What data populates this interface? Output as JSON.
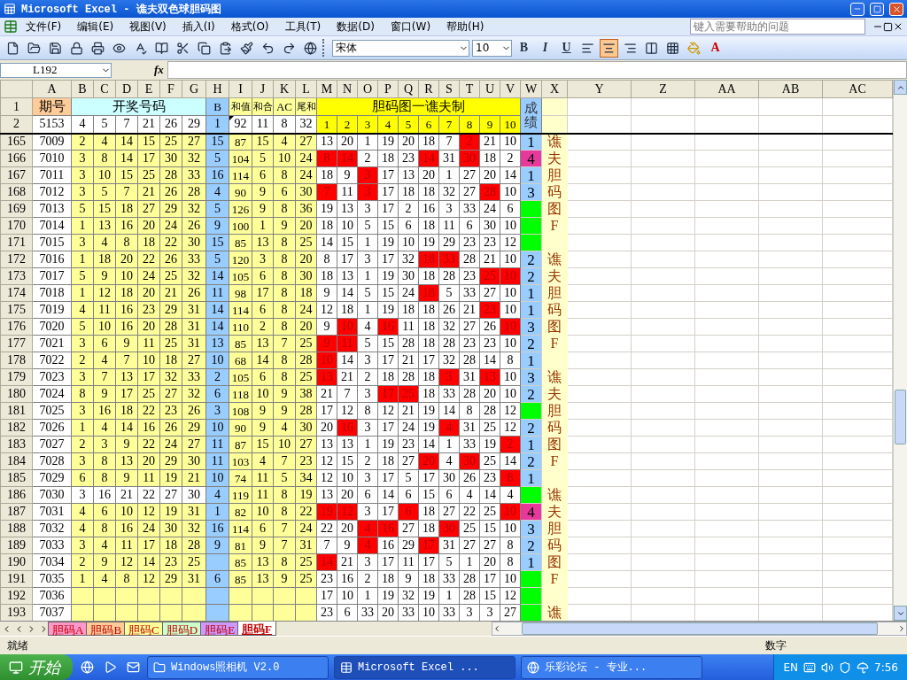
{
  "window": {
    "title": "Microsoft Excel - 谯夫双色球胆码图"
  },
  "menu": {
    "items": [
      "文件(F)",
      "编辑(E)",
      "视图(V)",
      "插入(I)",
      "格式(O)",
      "工具(T)",
      "数据(D)",
      "窗口(W)",
      "帮助(H)"
    ],
    "help_placeholder": "键入需要帮助的问题"
  },
  "toolbar": {
    "font": "宋体",
    "size": "10",
    "format_buttons": [
      "B",
      "I",
      "U"
    ],
    "align_buttons": [
      {
        "selected": false
      },
      {
        "selected": true
      },
      {
        "selected": false
      }
    ],
    "font_color_glyph": "A"
  },
  "formula_bar": {
    "name_box": "L192",
    "function_label": "fx"
  },
  "columns": [
    "A",
    "B",
    "C",
    "D",
    "E",
    "F",
    "G",
    "H",
    "I",
    "J",
    "K",
    "L",
    "M",
    "N",
    "O",
    "P",
    "Q",
    "R",
    "S",
    "T",
    "U",
    "V",
    "W",
    "X",
    "Y",
    "Z",
    "AA",
    "AB",
    "AC"
  ],
  "header": {
    "row1": {
      "num": "1",
      "issue": "期号",
      "balls": "开奖号码",
      "b": "B",
      "sum": "和值",
      "hh": "和合",
      "ac": "AC",
      "wh": "尾和",
      "dan": "胆码图一谯夫制",
      "score": "成绩"
    },
    "row2": {
      "num": "2",
      "id": "5153",
      "balls": [
        "4",
        "5",
        "7",
        "21",
        "26",
        "29"
      ],
      "b": "1",
      "sum": "92",
      "hh": "11",
      "ac": "8",
      "wh": "32",
      "dan": [
        "1",
        "2",
        "3",
        "4",
        "5",
        "6",
        "7",
        "8",
        "9",
        "10"
      ]
    }
  },
  "rows": [
    {
      "num": "165",
      "id": "7009",
      "shaded": true,
      "balls": [
        "2",
        "4",
        "14",
        "15",
        "25",
        "27"
      ],
      "b": "15",
      "sum": "87",
      "hh": "15",
      "ac": "4",
      "wh": "27",
      "dan": [
        {
          "value": "13",
          "hit": false
        },
        {
          "value": "20",
          "hit": false
        },
        {
          "value": "1",
          "hit": false
        },
        {
          "value": "19",
          "hit": false
        },
        {
          "value": "20",
          "hit": false
        },
        {
          "value": "18",
          "hit": false
        },
        {
          "value": "7",
          "hit": false
        },
        {
          "value": "2",
          "hit": true
        },
        {
          "value": "21",
          "hit": false
        },
        {
          "value": "10",
          "hit": false
        }
      ],
      "score": "1",
      "color": "#99ccff",
      "side": "谯"
    },
    {
      "num": "166",
      "id": "7010",
      "shaded": true,
      "balls": [
        "3",
        "8",
        "14",
        "17",
        "30",
        "32"
      ],
      "b": "5",
      "sum": "104",
      "hh": "5",
      "ac": "10",
      "wh": "24",
      "dan": [
        {
          "value": "8",
          "hit": true
        },
        {
          "value": "14",
          "hit": true
        },
        {
          "value": "2",
          "hit": false
        },
        {
          "value": "18",
          "hit": false
        },
        {
          "value": "23",
          "hit": false
        },
        {
          "value": "14",
          "hit": true
        },
        {
          "value": "31",
          "hit": false
        },
        {
          "value": "30",
          "hit": true
        },
        {
          "value": "18",
          "hit": false
        },
        {
          "value": "2",
          "hit": false
        }
      ],
      "score": "4",
      "color": "#e6399b",
      "side": "夫"
    },
    {
      "num": "167",
      "id": "7011",
      "shaded": true,
      "balls": [
        "3",
        "10",
        "15",
        "25",
        "28",
        "33"
      ],
      "b": "16",
      "sum": "114",
      "hh": "6",
      "ac": "8",
      "wh": "24",
      "dan": [
        {
          "value": "18",
          "hit": false
        },
        {
          "value": "9",
          "hit": false
        },
        {
          "value": "3",
          "hit": true
        },
        {
          "value": "17",
          "hit": false
        },
        {
          "value": "13",
          "hit": false
        },
        {
          "value": "20",
          "hit": false
        },
        {
          "value": "1",
          "hit": false
        },
        {
          "value": "27",
          "hit": false
        },
        {
          "value": "20",
          "hit": false
        },
        {
          "value": "14",
          "hit": false
        }
      ],
      "score": "1",
      "color": "#99ccff",
      "side": "胆"
    },
    {
      "num": "168",
      "id": "7012",
      "shaded": true,
      "balls": [
        "3",
        "5",
        "7",
        "21",
        "26",
        "28"
      ],
      "b": "4",
      "sum": "90",
      "hh": "9",
      "ac": "6",
      "wh": "30",
      "dan": [
        {
          "value": "7",
          "hit": true
        },
        {
          "value": "11",
          "hit": false
        },
        {
          "value": "3",
          "hit": true
        },
        {
          "value": "17",
          "hit": false
        },
        {
          "value": "18",
          "hit": false
        },
        {
          "value": "18",
          "hit": false
        },
        {
          "value": "32",
          "hit": false
        },
        {
          "value": "27",
          "hit": false
        },
        {
          "value": "28",
          "hit": true
        },
        {
          "value": "10",
          "hit": false
        }
      ],
      "score": "3",
      "color": "#99ccff",
      "side": "码"
    },
    {
      "num": "169",
      "id": "7013",
      "shaded": true,
      "balls": [
        "5",
        "15",
        "18",
        "27",
        "29",
        "32"
      ],
      "b": "5",
      "sum": "126",
      "hh": "9",
      "ac": "8",
      "wh": "36",
      "dan": [
        {
          "value": "19",
          "hit": false
        },
        {
          "value": "13",
          "hit": false
        },
        {
          "value": "3",
          "hit": false
        },
        {
          "value": "17",
          "hit": false
        },
        {
          "value": "2",
          "hit": false
        },
        {
          "value": "16",
          "hit": false
        },
        {
          "value": "3",
          "hit": false
        },
        {
          "value": "33",
          "hit": false
        },
        {
          "value": "24",
          "hit": false
        },
        {
          "value": "6",
          "hit": false
        }
      ],
      "color": "#00ff00",
      "side": "图"
    },
    {
      "num": "170",
      "id": "7014",
      "shaded": true,
      "balls": [
        "1",
        "13",
        "16",
        "20",
        "24",
        "26"
      ],
      "b": "9",
      "sum": "100",
      "hh": "1",
      "ac": "9",
      "wh": "20",
      "dan": [
        {
          "value": "18",
          "hit": false
        },
        {
          "value": "10",
          "hit": false
        },
        {
          "value": "5",
          "hit": false
        },
        {
          "value": "15",
          "hit": false
        },
        {
          "value": "6",
          "hit": false
        },
        {
          "value": "18",
          "hit": false
        },
        {
          "value": "11",
          "hit": false
        },
        {
          "value": "6",
          "hit": false
        },
        {
          "value": "30",
          "hit": false
        },
        {
          "value": "10",
          "hit": false
        }
      ],
      "color": "#00ff00",
      "side": "F"
    },
    {
      "num": "171",
      "id": "7015",
      "shaded": true,
      "balls": [
        "3",
        "4",
        "8",
        "18",
        "22",
        "30"
      ],
      "b": "15",
      "sum": "85",
      "hh": "13",
      "ac": "8",
      "wh": "25",
      "dan": [
        {
          "value": "14",
          "hit": false
        },
        {
          "value": "15",
          "hit": false
        },
        {
          "value": "1",
          "hit": false
        },
        {
          "value": "19",
          "hit": false
        },
        {
          "value": "10",
          "hit": false
        },
        {
          "value": "19",
          "hit": false
        },
        {
          "value": "29",
          "hit": false
        },
        {
          "value": "23",
          "hit": false
        },
        {
          "value": "23",
          "hit": false
        },
        {
          "value": "12",
          "hit": false
        }
      ],
      "color": "#00ff00"
    },
    {
      "num": "172",
      "id": "7016",
      "shaded": true,
      "balls": [
        "1",
        "18",
        "20",
        "22",
        "26",
        "33"
      ],
      "b": "5",
      "sum": "120",
      "hh": "3",
      "ac": "8",
      "wh": "20",
      "dan": [
        {
          "value": "8",
          "hit": false
        },
        {
          "value": "17",
          "hit": false
        },
        {
          "value": "3",
          "hit": false
        },
        {
          "value": "17",
          "hit": false
        },
        {
          "value": "32",
          "hit": false
        },
        {
          "value": "18",
          "hit": true
        },
        {
          "value": "33",
          "hit": true
        },
        {
          "value": "28",
          "hit": false
        },
        {
          "value": "21",
          "hit": false
        },
        {
          "value": "10",
          "hit": false
        }
      ],
      "score": "2",
      "color": "#99ccff",
      "side": "谯"
    },
    {
      "num": "173",
      "id": "7017",
      "shaded": true,
      "balls": [
        "5",
        "9",
        "10",
        "24",
        "25",
        "32"
      ],
      "b": "14",
      "sum": "105",
      "hh": "6",
      "ac": "8",
      "wh": "30",
      "dan": [
        {
          "value": "18",
          "hit": false
        },
        {
          "value": "13",
          "hit": false
        },
        {
          "value": "1",
          "hit": false
        },
        {
          "value": "19",
          "hit": false
        },
        {
          "value": "30",
          "hit": false
        },
        {
          "value": "18",
          "hit": false
        },
        {
          "value": "28",
          "hit": false
        },
        {
          "value": "23",
          "hit": false
        },
        {
          "value": "25",
          "hit": true
        },
        {
          "value": "10",
          "hit": true
        }
      ],
      "score": "2",
      "color": "#99ccff",
      "side": "夫"
    },
    {
      "num": "174",
      "id": "7018",
      "shaded": true,
      "balls": [
        "1",
        "12",
        "18",
        "20",
        "21",
        "26"
      ],
      "b": "11",
      "sum": "98",
      "hh": "17",
      "ac": "8",
      "wh": "18",
      "dan": [
        {
          "value": "9",
          "hit": false
        },
        {
          "value": "14",
          "hit": false
        },
        {
          "value": "5",
          "hit": false
        },
        {
          "value": "15",
          "hit": false
        },
        {
          "value": "24",
          "hit": false
        },
        {
          "value": "18",
          "hit": true
        },
        {
          "value": "5",
          "hit": false
        },
        {
          "value": "33",
          "hit": false
        },
        {
          "value": "27",
          "hit": false
        },
        {
          "value": "10",
          "hit": false
        }
      ],
      "score": "1",
      "color": "#99ccff",
      "side": "胆"
    },
    {
      "num": "175",
      "id": "7019",
      "shaded": true,
      "balls": [
        "4",
        "11",
        "16",
        "23",
        "29",
        "31"
      ],
      "b": "14",
      "sum": "114",
      "hh": "6",
      "ac": "8",
      "wh": "24",
      "dan": [
        {
          "value": "12",
          "hit": false
        },
        {
          "value": "18",
          "hit": false
        },
        {
          "value": "1",
          "hit": false
        },
        {
          "value": "19",
          "hit": false
        },
        {
          "value": "18",
          "hit": false
        },
        {
          "value": "18",
          "hit": false
        },
        {
          "value": "26",
          "hit": false
        },
        {
          "value": "21",
          "hit": false
        },
        {
          "value": "23",
          "hit": true
        },
        {
          "value": "10",
          "hit": false
        }
      ],
      "score": "1",
      "color": "#99ccff",
      "side": "码"
    },
    {
      "num": "176",
      "id": "7020",
      "shaded": true,
      "balls": [
        "5",
        "10",
        "16",
        "20",
        "28",
        "31"
      ],
      "b": "14",
      "sum": "110",
      "hh": "2",
      "ac": "8",
      "wh": "20",
      "dan": [
        {
          "value": "9",
          "hit": false
        },
        {
          "value": "10",
          "hit": true
        },
        {
          "value": "4",
          "hit": false
        },
        {
          "value": "16",
          "hit": true
        },
        {
          "value": "11",
          "hit": false
        },
        {
          "value": "18",
          "hit": false
        },
        {
          "value": "32",
          "hit": false
        },
        {
          "value": "27",
          "hit": false
        },
        {
          "value": "26",
          "hit": false
        },
        {
          "value": "10",
          "hit": true
        }
      ],
      "score": "3",
      "color": "#99ccff",
      "side": "图"
    },
    {
      "num": "177",
      "id": "7021",
      "shaded": true,
      "balls": [
        "3",
        "6",
        "9",
        "11",
        "25",
        "31"
      ],
      "b": "13",
      "sum": "85",
      "hh": "13",
      "ac": "7",
      "wh": "25",
      "dan": [
        {
          "value": "9",
          "hit": true
        },
        {
          "value": "11",
          "hit": true
        },
        {
          "value": "5",
          "hit": false
        },
        {
          "value": "15",
          "hit": false
        },
        {
          "value": "28",
          "hit": false
        },
        {
          "value": "18",
          "hit": false
        },
        {
          "value": "28",
          "hit": false
        },
        {
          "value": "23",
          "hit": false
        },
        {
          "value": "23",
          "hit": false
        },
        {
          "value": "10",
          "hit": false
        }
      ],
      "score": "2",
      "color": "#99ccff",
      "side": "F"
    },
    {
      "num": "178",
      "id": "7022",
      "shaded": true,
      "balls": [
        "2",
        "4",
        "7",
        "10",
        "18",
        "27"
      ],
      "b": "10",
      "sum": "68",
      "hh": "14",
      "ac": "8",
      "wh": "28",
      "dan": [
        {
          "value": "10",
          "hit": true
        },
        {
          "value": "14",
          "hit": false
        },
        {
          "value": "3",
          "hit": false
        },
        {
          "value": "17",
          "hit": false
        },
        {
          "value": "21",
          "hit": false
        },
        {
          "value": "17",
          "hit": false
        },
        {
          "value": "32",
          "hit": false
        },
        {
          "value": "28",
          "hit": false
        },
        {
          "value": "14",
          "hit": false
        },
        {
          "value": "8",
          "hit": false
        }
      ],
      "score": "1",
      "color": "#99ccff"
    },
    {
      "num": "179",
      "id": "7023",
      "shaded": true,
      "balls": [
        "3",
        "7",
        "13",
        "17",
        "32",
        "33"
      ],
      "b": "2",
      "sum": "105",
      "hh": "6",
      "ac": "8",
      "wh": "25",
      "dan": [
        {
          "value": "13",
          "hit": true
        },
        {
          "value": "21",
          "hit": false
        },
        {
          "value": "2",
          "hit": false
        },
        {
          "value": "18",
          "hit": false
        },
        {
          "value": "28",
          "hit": false
        },
        {
          "value": "18",
          "hit": false
        },
        {
          "value": "3",
          "hit": true
        },
        {
          "value": "31",
          "hit": false
        },
        {
          "value": "13",
          "hit": true
        },
        {
          "value": "10",
          "hit": false
        }
      ],
      "score": "3",
      "color": "#99ccff",
      "side": "谯"
    },
    {
      "num": "180",
      "id": "7024",
      "shaded": true,
      "balls": [
        "8",
        "9",
        "17",
        "25",
        "27",
        "32"
      ],
      "b": "6",
      "sum": "118",
      "hh": "10",
      "ac": "9",
      "wh": "38",
      "dan": [
        {
          "value": "21",
          "hit": false
        },
        {
          "value": "7",
          "hit": false
        },
        {
          "value": "3",
          "hit": false
        },
        {
          "value": "17",
          "hit": true
        },
        {
          "value": "25",
          "hit": true
        },
        {
          "value": "18",
          "hit": false
        },
        {
          "value": "33",
          "hit": false
        },
        {
          "value": "28",
          "hit": false
        },
        {
          "value": "20",
          "hit": false
        },
        {
          "value": "10",
          "hit": false
        }
      ],
      "score": "2",
      "color": "#99ccff",
      "side": "夫"
    },
    {
      "num": "181",
      "id": "7025",
      "shaded": true,
      "balls": [
        "3",
        "16",
        "18",
        "22",
        "23",
        "26"
      ],
      "b": "3",
      "sum": "108",
      "hh": "9",
      "ac": "9",
      "wh": "28",
      "dan": [
        {
          "value": "17",
          "hit": false
        },
        {
          "value": "12",
          "hit": false
        },
        {
          "value": "8",
          "hit": false
        },
        {
          "value": "12",
          "hit": false
        },
        {
          "value": "21",
          "hit": false
        },
        {
          "value": "19",
          "hit": false
        },
        {
          "value": "14",
          "hit": false
        },
        {
          "value": "8",
          "hit": false
        },
        {
          "value": "28",
          "hit": false
        },
        {
          "value": "12",
          "hit": false
        }
      ],
      "color": "#00ff00",
      "side": "胆"
    },
    {
      "num": "182",
      "id": "7026",
      "shaded": true,
      "balls": [
        "1",
        "4",
        "14",
        "16",
        "26",
        "29"
      ],
      "b": "10",
      "sum": "90",
      "hh": "9",
      "ac": "4",
      "wh": "30",
      "dan": [
        {
          "value": "20",
          "hit": false
        },
        {
          "value": "16",
          "hit": true
        },
        {
          "value": "3",
          "hit": false
        },
        {
          "value": "17",
          "hit": false
        },
        {
          "value": "24",
          "hit": false
        },
        {
          "value": "19",
          "hit": false
        },
        {
          "value": "4",
          "hit": true
        },
        {
          "value": "31",
          "hit": false
        },
        {
          "value": "25",
          "hit": false
        },
        {
          "value": "12",
          "hit": false
        }
      ],
      "score": "2",
      "color": "#99ccff",
      "side": "码"
    },
    {
      "num": "183",
      "id": "7027",
      "shaded": true,
      "balls": [
        "2",
        "3",
        "9",
        "22",
        "24",
        "27"
      ],
      "b": "11",
      "sum": "87",
      "hh": "15",
      "ac": "10",
      "wh": "27",
      "dan": [
        {
          "value": "13",
          "hit": false
        },
        {
          "value": "13",
          "hit": false
        },
        {
          "value": "1",
          "hit": false
        },
        {
          "value": "19",
          "hit": false
        },
        {
          "value": "23",
          "hit": false
        },
        {
          "value": "14",
          "hit": false
        },
        {
          "value": "1",
          "hit": false
        },
        {
          "value": "33",
          "hit": false
        },
        {
          "value": "19",
          "hit": false
        },
        {
          "value": "2",
          "hit": true
        }
      ],
      "score": "1",
      "color": "#99ccff",
      "side": "图"
    },
    {
      "num": "184",
      "id": "7028",
      "shaded": true,
      "balls": [
        "3",
        "8",
        "13",
        "20",
        "29",
        "30"
      ],
      "b": "11",
      "sum": "103",
      "hh": "4",
      "ac": "7",
      "wh": "23",
      "dan": [
        {
          "value": "12",
          "hit": false
        },
        {
          "value": "15",
          "hit": false
        },
        {
          "value": "2",
          "hit": false
        },
        {
          "value": "18",
          "hit": false
        },
        {
          "value": "27",
          "hit": false
        },
        {
          "value": "20",
          "hit": true
        },
        {
          "value": "4",
          "hit": false
        },
        {
          "value": "30",
          "hit": true
        },
        {
          "value": "25",
          "hit": false
        },
        {
          "value": "14",
          "hit": false
        }
      ],
      "score": "2",
      "color": "#99ccff",
      "side": "F"
    },
    {
      "num": "185",
      "id": "7029",
      "shaded": true,
      "balls": [
        "6",
        "8",
        "9",
        "11",
        "19",
        "21"
      ],
      "b": "10",
      "sum": "74",
      "hh": "11",
      "ac": "5",
      "wh": "34",
      "dan": [
        {
          "value": "12",
          "hit": false
        },
        {
          "value": "10",
          "hit": false
        },
        {
          "value": "3",
          "hit": false
        },
        {
          "value": "17",
          "hit": false
        },
        {
          "value": "5",
          "hit": false
        },
        {
          "value": "17",
          "hit": false
        },
        {
          "value": "30",
          "hit": false
        },
        {
          "value": "26",
          "hit": false
        },
        {
          "value": "23",
          "hit": false
        },
        {
          "value": "8",
          "hit": true
        }
      ],
      "score": "1",
      "color": "#99ccff"
    },
    {
      "num": "186",
      "id": "7030",
      "shaded": false,
      "balls": [
        "3",
        "16",
        "21",
        "22",
        "27",
        "30"
      ],
      "b": "4",
      "sum": "119",
      "hh": "11",
      "ac": "8",
      "wh": "19",
      "dan": [
        {
          "value": "13",
          "hit": false
        },
        {
          "value": "20",
          "hit": false
        },
        {
          "value": "6",
          "hit": false
        },
        {
          "value": "14",
          "hit": false
        },
        {
          "value": "6",
          "hit": false
        },
        {
          "value": "15",
          "hit": false
        },
        {
          "value": "6",
          "hit": false
        },
        {
          "value": "4",
          "hit": false
        },
        {
          "value": "14",
          "hit": false
        },
        {
          "value": "4",
          "hit": false
        }
      ],
      "color": "#00ff00",
      "side": "谯"
    },
    {
      "num": "187",
      "id": "7031",
      "shaded": true,
      "balls": [
        "4",
        "6",
        "10",
        "12",
        "19",
        "31"
      ],
      "b": "1",
      "sum": "82",
      "hh": "10",
      "ac": "8",
      "wh": "22",
      "dan": [
        {
          "value": "19",
          "hit": true
        },
        {
          "value": "12",
          "hit": true
        },
        {
          "value": "3",
          "hit": false
        },
        {
          "value": "17",
          "hit": false
        },
        {
          "value": "6",
          "hit": true
        },
        {
          "value": "18",
          "hit": false
        },
        {
          "value": "27",
          "hit": false
        },
        {
          "value": "22",
          "hit": false
        },
        {
          "value": "25",
          "hit": false
        },
        {
          "value": "10",
          "hit": true
        }
      ],
      "score": "4",
      "color": "#e6399b",
      "side": "夫"
    },
    {
      "num": "188",
      "id": "7032",
      "shaded": true,
      "balls": [
        "4",
        "8",
        "16",
        "24",
        "30",
        "32"
      ],
      "b": "16",
      "sum": "114",
      "hh": "6",
      "ac": "7",
      "wh": "24",
      "dan": [
        {
          "value": "22",
          "hit": false
        },
        {
          "value": "20",
          "hit": false
        },
        {
          "value": "4",
          "hit": true
        },
        {
          "value": "16",
          "hit": true
        },
        {
          "value": "27",
          "hit": false
        },
        {
          "value": "18",
          "hit": false
        },
        {
          "value": "30",
          "hit": true
        },
        {
          "value": "25",
          "hit": false
        },
        {
          "value": "15",
          "hit": false
        },
        {
          "value": "10",
          "hit": false
        }
      ],
      "score": "3",
      "color": "#99ccff",
      "side": "胆"
    },
    {
      "num": "189",
      "id": "7033",
      "shaded": true,
      "balls": [
        "3",
        "4",
        "11",
        "17",
        "18",
        "28"
      ],
      "b": "9",
      "sum": "81",
      "hh": "9",
      "ac": "7",
      "wh": "31",
      "dan": [
        {
          "value": "7",
          "hit": false
        },
        {
          "value": "9",
          "hit": false
        },
        {
          "value": "4",
          "hit": true
        },
        {
          "value": "16",
          "hit": false
        },
        {
          "value": "29",
          "hit": false
        },
        {
          "value": "17",
          "hit": true
        },
        {
          "value": "31",
          "hit": false
        },
        {
          "value": "27",
          "hit": false
        },
        {
          "value": "27",
          "hit": false
        },
        {
          "value": "8",
          "hit": false
        }
      ],
      "score": "2",
      "color": "#99ccff",
      "side": "码"
    },
    {
      "num": "190",
      "id": "7034",
      "shaded": true,
      "balls": [
        "2",
        "9",
        "12",
        "14",
        "23",
        "25"
      ],
      "sum": "85",
      "hh": "13",
      "ac": "8",
      "wh": "25",
      "dan": [
        {
          "value": "14",
          "hit": true
        },
        {
          "value": "21",
          "hit": false
        },
        {
          "value": "3",
          "hit": false
        },
        {
          "value": "17",
          "hit": false
        },
        {
          "value": "11",
          "hit": false
        },
        {
          "value": "17",
          "hit": false
        },
        {
          "value": "5",
          "hit": false
        },
        {
          "value": "1",
          "hit": false
        },
        {
          "value": "20",
          "hit": false
        },
        {
          "value": "8",
          "hit": false
        }
      ],
      "score": "1",
      "color": "#99ccff",
      "side": "图"
    },
    {
      "num": "191",
      "id": "7035",
      "shaded": true,
      "balls": [
        "1",
        "4",
        "8",
        "12",
        "29",
        "31"
      ],
      "b": "6",
      "sum": "85",
      "hh": "13",
      "ac": "9",
      "wh": "25",
      "dan": [
        {
          "value": "23",
          "hit": false
        },
        {
          "value": "16",
          "hit": false
        },
        {
          "value": "2",
          "hit": false
        },
        {
          "value": "18",
          "hit": false
        },
        {
          "value": "9",
          "hit": false
        },
        {
          "value": "18",
          "hit": false
        },
        {
          "value": "33",
          "hit": false
        },
        {
          "value": "28",
          "hit": false
        },
        {
          "value": "17",
          "hit": false
        },
        {
          "value": "10",
          "hit": false
        }
      ],
      "color": "#00ff00",
      "side": "F"
    },
    {
      "num": "192",
      "id": "7036",
      "shaded": true,
      "dan": [
        {
          "value": "17",
          "hit": false
        },
        {
          "value": "10",
          "hit": false
        },
        {
          "value": "1",
          "hit": false
        },
        {
          "value": "19",
          "hit": false
        },
        {
          "value": "32",
          "hit": false
        },
        {
          "value": "19",
          "hit": false
        },
        {
          "value": "1",
          "hit": false
        },
        {
          "value": "28",
          "hit": false
        },
        {
          "value": "15",
          "hit": false
        },
        {
          "value": "12",
          "hit": false
        }
      ],
      "color": "#00ff00"
    },
    {
      "num": "193",
      "id": "7037",
      "shaded": true,
      "dan": [
        {
          "value": "23",
          "hit": false
        },
        {
          "value": "6",
          "hit": false
        },
        {
          "value": "33",
          "hit": false
        },
        {
          "value": "20",
          "hit": false
        },
        {
          "value": "33",
          "hit": false
        },
        {
          "value": "10",
          "hit": false
        },
        {
          "value": "33",
          "hit": false
        },
        {
          "value": "3",
          "hit": false
        },
        {
          "value": "3",
          "hit": false
        },
        {
          "value": "27",
          "hit": false
        }
      ],
      "color": "#00ff00",
      "side": "谯"
    }
  ],
  "sheet_tabs": [
    {
      "label": "胆码A",
      "color": "#ff99cc",
      "selected": false
    },
    {
      "label": "胆码B",
      "color": "#ffcc99",
      "selected": false
    },
    {
      "label": "胆码C",
      "color": "#ffff99",
      "selected": false
    },
    {
      "label": "胆码D",
      "color": "#ccffcc",
      "selected": false
    },
    {
      "label": "胆码E",
      "color": "#cc99ff",
      "selected": false
    },
    {
      "label": "胆码F",
      "color": "#ffffff",
      "selected": true
    }
  ],
  "status_bar": {
    "left": "就绪",
    "mode": "数字"
  },
  "taskbar": {
    "start": "开始",
    "tasks": [
      {
        "label": "Windows照相机 V2.0",
        "selected": false
      },
      {
        "label": "Microsoft Excel ...",
        "selected": true
      },
      {
        "label": "乐彩论坛 - 专业...",
        "selected": false
      }
    ],
    "language": "EN",
    "time": "7:56"
  }
}
